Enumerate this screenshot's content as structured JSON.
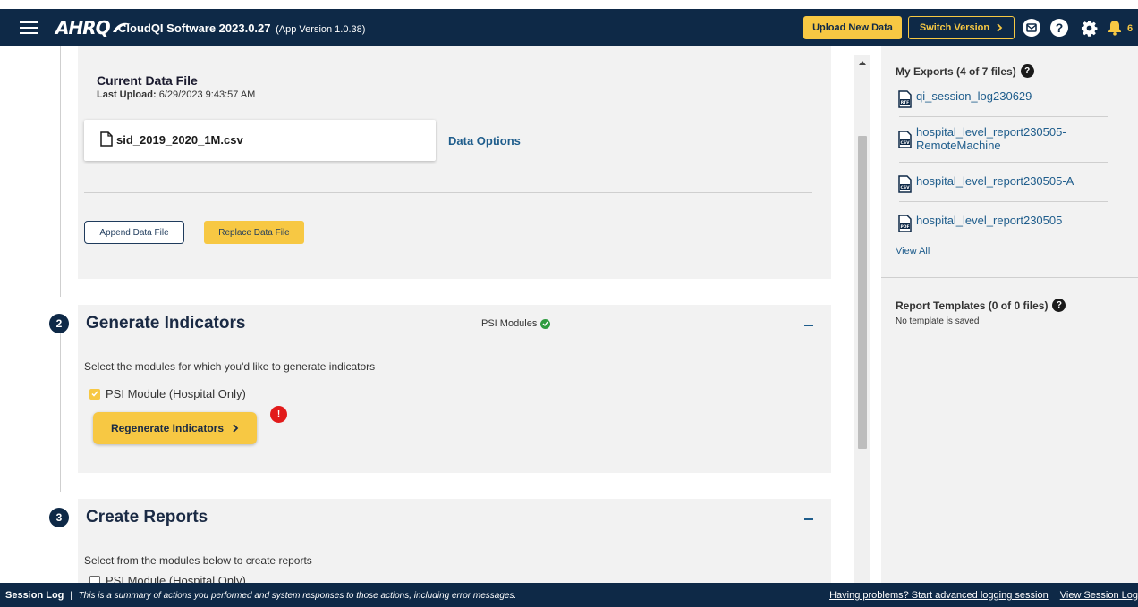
{
  "header": {
    "logo_text": "AHRQ",
    "app_title": "CloudQI Software 2023.0.27",
    "app_version": "(App Version 1.0.38)",
    "upload_label": "Upload New Data",
    "switch_label": "Switch Version",
    "notification_count": "6",
    "colors": {
      "bar": "#0e2947",
      "accent": "#f7c843"
    }
  },
  "current_file": {
    "title": "Current Data File",
    "last_upload_label": "Last Upload:",
    "last_upload_value": "6/29/2023 9:43:57 AM",
    "file_name": "sid_2019_2020_1M.csv",
    "data_options": "Data Options",
    "append_label": "Append Data File",
    "replace_label": "Replace Data File"
  },
  "generate": {
    "step": "2",
    "heading": "Generate Indicators",
    "status_label": "PSI Modules",
    "description": "Select the modules for which you'd like to generate indicators",
    "module_label": "PSI Module (Hospital Only)",
    "button_label": "Regenerate Indicators",
    "alert_text": "!"
  },
  "create": {
    "step": "3",
    "heading": "Create Reports",
    "description": "Select from the modules below to create reports",
    "module_label": "PSI Module (Hospital Only)"
  },
  "exports": {
    "title": "My Exports (4 of 7 files)",
    "items": [
      {
        "type": "RTF",
        "name": "qi_session_log230629"
      },
      {
        "type": "CSV",
        "name": "hospital_level_report230505-RemoteMachine"
      },
      {
        "type": "CSV",
        "name": "hospital_level_report230505-A"
      },
      {
        "type": "PDF",
        "name": "hospital_level_report230505"
      }
    ],
    "view_all": "View All"
  },
  "templates": {
    "title": "Report Templates (0 of 0 files)",
    "empty_text": "No template is saved"
  },
  "footer": {
    "label": "Session Log",
    "separator": "|",
    "description": "This is a summary of actions you performed and system responses to those actions, including error messages.",
    "advanced_link": "Having problems? Start advanced logging session",
    "view_log_link": "View Session Log"
  }
}
